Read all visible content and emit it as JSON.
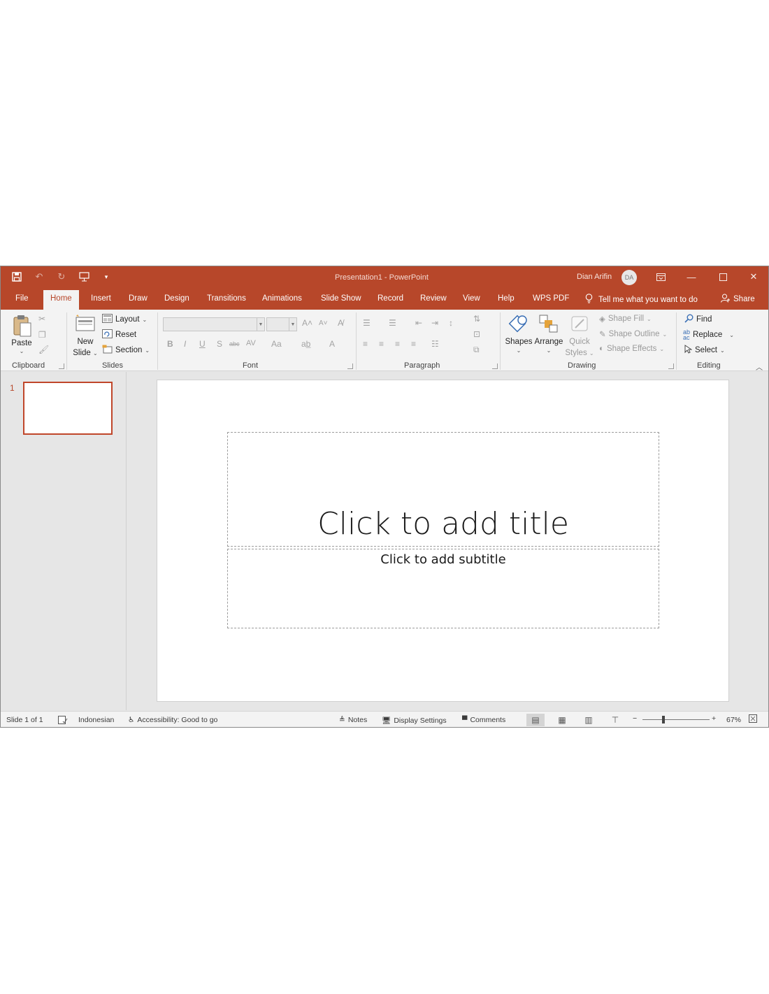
{
  "app": {
    "doc_title": "Presentation1  -  PowerPoint",
    "user_name": "Dian Arifin",
    "user_initials": "DA"
  },
  "tabs": [
    "File",
    "Home",
    "Insert",
    "Draw",
    "Design",
    "Transitions",
    "Animations",
    "Slide Show",
    "Record",
    "Review",
    "View",
    "Help",
    "WPS PDF"
  ],
  "active_tab": "Home",
  "tell_me": "Tell me what you want to do",
  "share": "Share",
  "ribbon": {
    "clipboard": {
      "paste": "Paste",
      "label": "Clipboard"
    },
    "slides": {
      "new_slide_1": "New",
      "new_slide_2": "Slide",
      "layout": "Layout",
      "reset": "Reset",
      "section": "Section",
      "label": "Slides"
    },
    "font": {
      "label": "Font",
      "bold": "B",
      "italic": "I",
      "underline": "U",
      "shadow": "S",
      "strike": "abc",
      "spacing": "AV",
      "case": "Aa",
      "color": "A"
    },
    "paragraph": {
      "label": "Paragraph"
    },
    "drawing": {
      "shapes": "Shapes",
      "arrange": "Arrange",
      "quick_1": "Quick",
      "quick_2": "Styles",
      "shape_fill": "Shape Fill",
      "shape_outline": "Shape Outline",
      "shape_effects": "Shape Effects",
      "label": "Drawing"
    },
    "editing": {
      "find": "Find",
      "replace": "Replace",
      "select": "Select",
      "label": "Editing"
    }
  },
  "thumbnails": [
    {
      "number": "1"
    }
  ],
  "slide": {
    "title_placeholder": "Click to add title",
    "subtitle_placeholder": "Click to add subtitle"
  },
  "status": {
    "slide_info": "Slide 1 of 1",
    "language": "Indonesian",
    "accessibility": "Accessibility: Good to go",
    "notes": "Notes",
    "display_settings": "Display Settings",
    "comments": "Comments",
    "zoom": "67%"
  },
  "colors": {
    "accent": "#b7472a",
    "ribbon_bg": "#f3f3f3",
    "workspace": "#e6e6e6"
  },
  "icons": [
    "save-icon",
    "undo-icon",
    "redo-icon",
    "present-icon",
    "customize-icon",
    "lightbulb-icon",
    "person-icon",
    "paste-icon",
    "cut-icon",
    "copy-icon",
    "format-painter-icon",
    "new-slide-icon",
    "layout-icon",
    "reset-icon",
    "section-icon",
    "shapes-icon",
    "arrange-icon",
    "quick-styles-icon",
    "find-icon",
    "replace-icon",
    "select-icon"
  ]
}
